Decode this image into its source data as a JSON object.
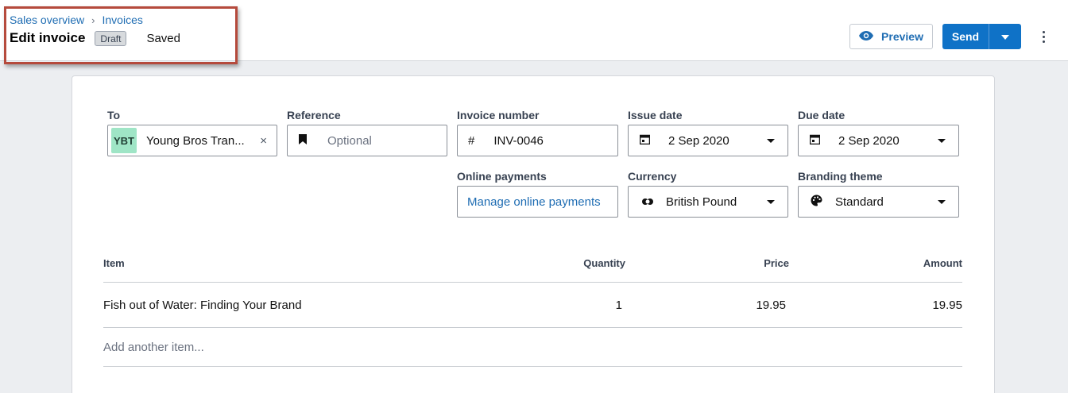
{
  "breadcrumb": {
    "items": [
      "Sales overview",
      "Invoices"
    ],
    "separator": "›"
  },
  "header": {
    "title": "Edit invoice",
    "status_badge": "Draft",
    "save_status": "Saved",
    "preview_label": "Preview",
    "send_label": "Send"
  },
  "form": {
    "to": {
      "label": "To",
      "initials": "YBT",
      "value": "Young Bros Tran...",
      "clear_icon": "×"
    },
    "reference": {
      "label": "Reference",
      "placeholder": "Optional"
    },
    "invoice_number": {
      "label": "Invoice number",
      "prefix": "#",
      "value": "INV-0046"
    },
    "issue_date": {
      "label": "Issue date",
      "value": "2 Sep 2020"
    },
    "due_date": {
      "label": "Due date",
      "value": "2 Sep 2020"
    },
    "online_payments": {
      "label": "Online payments",
      "link": "Manage online payments"
    },
    "currency": {
      "label": "Currency",
      "value": "British Pound"
    },
    "branding_theme": {
      "label": "Branding theme",
      "value": "Standard"
    }
  },
  "table": {
    "columns": [
      "Item",
      "Quantity",
      "Price",
      "Amount"
    ],
    "rows": [
      {
        "item": "Fish out of Water: Finding Your Brand",
        "quantity": "1",
        "price": "19.95",
        "amount": "19.95"
      }
    ],
    "add_placeholder": "Add another item..."
  },
  "colors": {
    "accent": "#0f72c7",
    "link": "#1f6db3",
    "contact_tag": "#9fe5c6",
    "highlight_border": "#b54a3c"
  },
  "icons": [
    "eye-icon",
    "chevron-down-icon",
    "more-vertical-icon",
    "bookmark-icon",
    "calendar-icon",
    "currency-icon",
    "palette-icon",
    "close-icon"
  ]
}
